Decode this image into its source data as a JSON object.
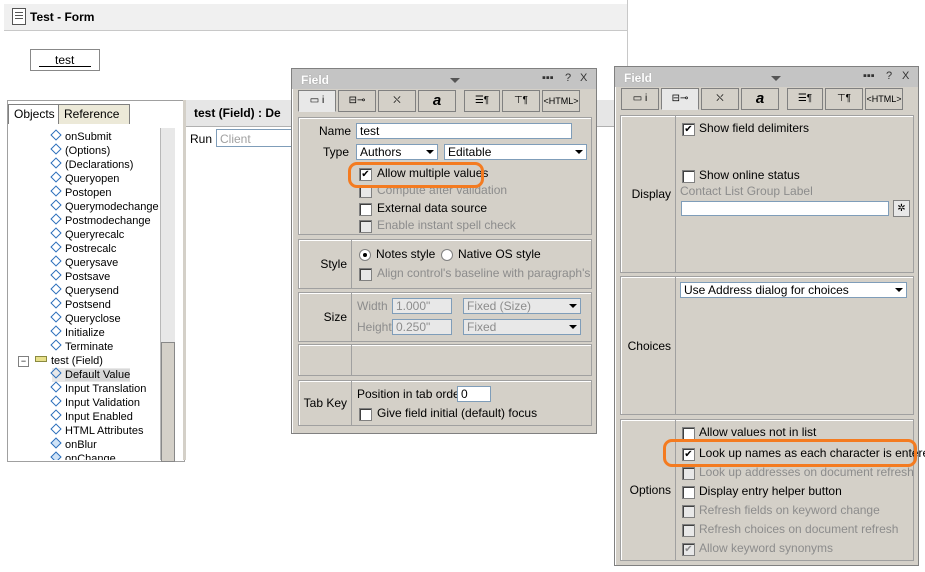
{
  "window": {
    "title": "Test - Form"
  },
  "form": {
    "field_text": "test"
  },
  "left_tabs": [
    "Objects",
    "Reference"
  ],
  "tree": [
    {
      "label": "onSubmit"
    },
    {
      "label": "(Options)"
    },
    {
      "label": "(Declarations)"
    },
    {
      "label": "Queryopen"
    },
    {
      "label": "Postopen"
    },
    {
      "label": "Querymodechange"
    },
    {
      "label": "Postmodechange"
    },
    {
      "label": "Queryrecalc"
    },
    {
      "label": "Postrecalc"
    },
    {
      "label": "Querysave"
    },
    {
      "label": "Postsave"
    },
    {
      "label": "Querysend"
    },
    {
      "label": "Postsend"
    },
    {
      "label": "Queryclose"
    },
    {
      "label": "Initialize"
    },
    {
      "label": "Terminate"
    },
    {
      "label": "test (Field)"
    },
    {
      "label": "Default Value"
    },
    {
      "label": "Input Translation"
    },
    {
      "label": "Input Validation"
    },
    {
      "label": "Input Enabled"
    },
    {
      "label": "HTML Attributes"
    },
    {
      "label": "onBlur"
    },
    {
      "label": "onChange"
    }
  ],
  "code": {
    "header": "test (Field) : De",
    "run_label": "Run",
    "run_value": "Client"
  },
  "field_box_1": {
    "title": "Field",
    "buttons": {
      "help": "?",
      "close": "X"
    },
    "tab_html": "<HTML>",
    "tab_a": "a",
    "name_label": "Name",
    "name_value": "test",
    "type_label": "Type",
    "type_value": "Authors",
    "type_mode": "Editable",
    "allow_multiple": "Allow multiple values",
    "compute_after": "Compute after validation",
    "external_ds": "External data source",
    "spell_check": "Enable instant spell check",
    "style_label": "Style",
    "notes_style": "Notes style",
    "native_os": "Native OS style",
    "align_baseline": "Align control's baseline with paragraph's",
    "size_label": "Size",
    "width_label": "Width",
    "width_value": "1.000\"",
    "width_mode": "Fixed (Size)",
    "height_label": "Height",
    "height_value": "0.250\"",
    "height_mode": "Fixed",
    "tabkey_label": "Tab Key",
    "tab_order_label": "Position in tab order",
    "tab_order_value": "0",
    "initial_focus": "Give field initial (default) focus"
  },
  "field_box_2": {
    "title": "Field",
    "buttons": {
      "help": "?",
      "close": "X"
    },
    "tab_html": "<HTML>",
    "tab_a": "a",
    "display_label": "Display",
    "show_delims": "Show field delimiters",
    "show_online": "Show online status",
    "contact_group": "Contact List Group Label",
    "choices_label": "Choices",
    "choices_value": "Use Address dialog for choices",
    "options_label": "Options",
    "allow_not_in_list": "Allow values not in list",
    "lookup_names": "Look up names as each character is entered",
    "lookup_addresses": "Look up addresses on document refresh",
    "entry_helper": "Display entry helper button",
    "refresh_fields": "Refresh fields on keyword change",
    "refresh_choices": "Refresh choices on document refresh",
    "keyword_synonyms": "Allow keyword synonyms"
  },
  "colors": {
    "highlight": "#f47b20",
    "panel": "#d4d0c8"
  }
}
